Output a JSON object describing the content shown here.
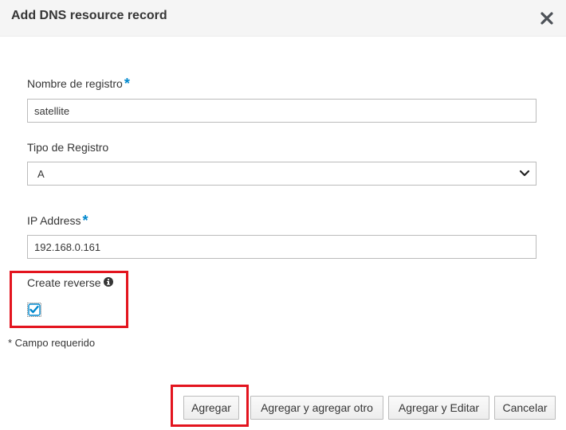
{
  "dialog": {
    "title": "Add DNS resource record",
    "close_icon": "close-icon"
  },
  "form": {
    "record_name": {
      "label": "Nombre de registro",
      "required_marker": "*",
      "value": "satellite"
    },
    "record_type": {
      "label": "Tipo de Registro",
      "selected": "A",
      "icon": "chevron-down-icon"
    },
    "ip_address": {
      "label": "IP Address",
      "required_marker": "*",
      "value": "192.168.0.161"
    },
    "create_reverse": {
      "label": "Create reverse",
      "info_icon": "info-icon",
      "checked": true
    },
    "required_note": "* Campo requerido"
  },
  "footer": {
    "add_label": "Agregar",
    "add_another_label": "Agregar y agregar otro",
    "add_edit_label": "Agregar y Editar",
    "cancel_label": "Cancelar"
  },
  "colors": {
    "required": "#0088ce",
    "highlight": "#e3141e",
    "checkbox": "#0088ce",
    "header_bg": "#f5f5f5"
  }
}
